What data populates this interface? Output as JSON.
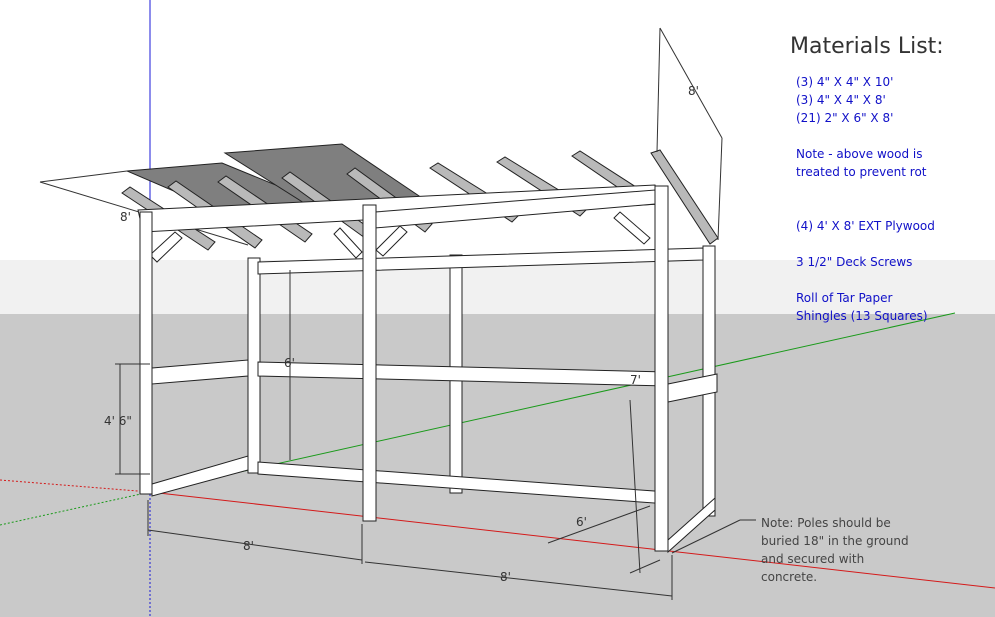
{
  "materials": {
    "title": "Materials List:",
    "lines": [
      "(3) 4\" X 4\" X 10'",
      "(3) 4\" X 4\" X  8'",
      "(21) 2\" X 6\" X 8'",
      "",
      "Note - above wood is",
      "treated to prevent rot",
      "",
      "",
      "(4) 4' X 8' EXT Plywood",
      "",
      "3 1/2\" Deck Screws",
      "",
      "Roll of Tar Paper",
      "Shingles (13 Squares)"
    ]
  },
  "dimensions": {
    "roof_depth": "8'",
    "roof_left": "8'",
    "rail_height": "4' 6\"",
    "post_height_6": "6'",
    "depth_7": "7'",
    "depth_6": "6'",
    "bay_left": "8'",
    "bay_right": "8'"
  },
  "note_poles": [
    "Note: Poles should be",
    "buried 18\" in the ground",
    "and secured with",
    "concrete."
  ],
  "colors": {
    "sky": "#ffffff",
    "ground": "#c9c9c9",
    "wood": "#ffffff",
    "wood_edge": "#222222",
    "roof_panel": "#7f7f7f",
    "rafter_side": "#b9b9b9",
    "axis_red": "#d41a1a",
    "axis_green": "#1a9a1a",
    "axis_blue": "#1a1ad8",
    "materials_text": "#1010c8"
  }
}
